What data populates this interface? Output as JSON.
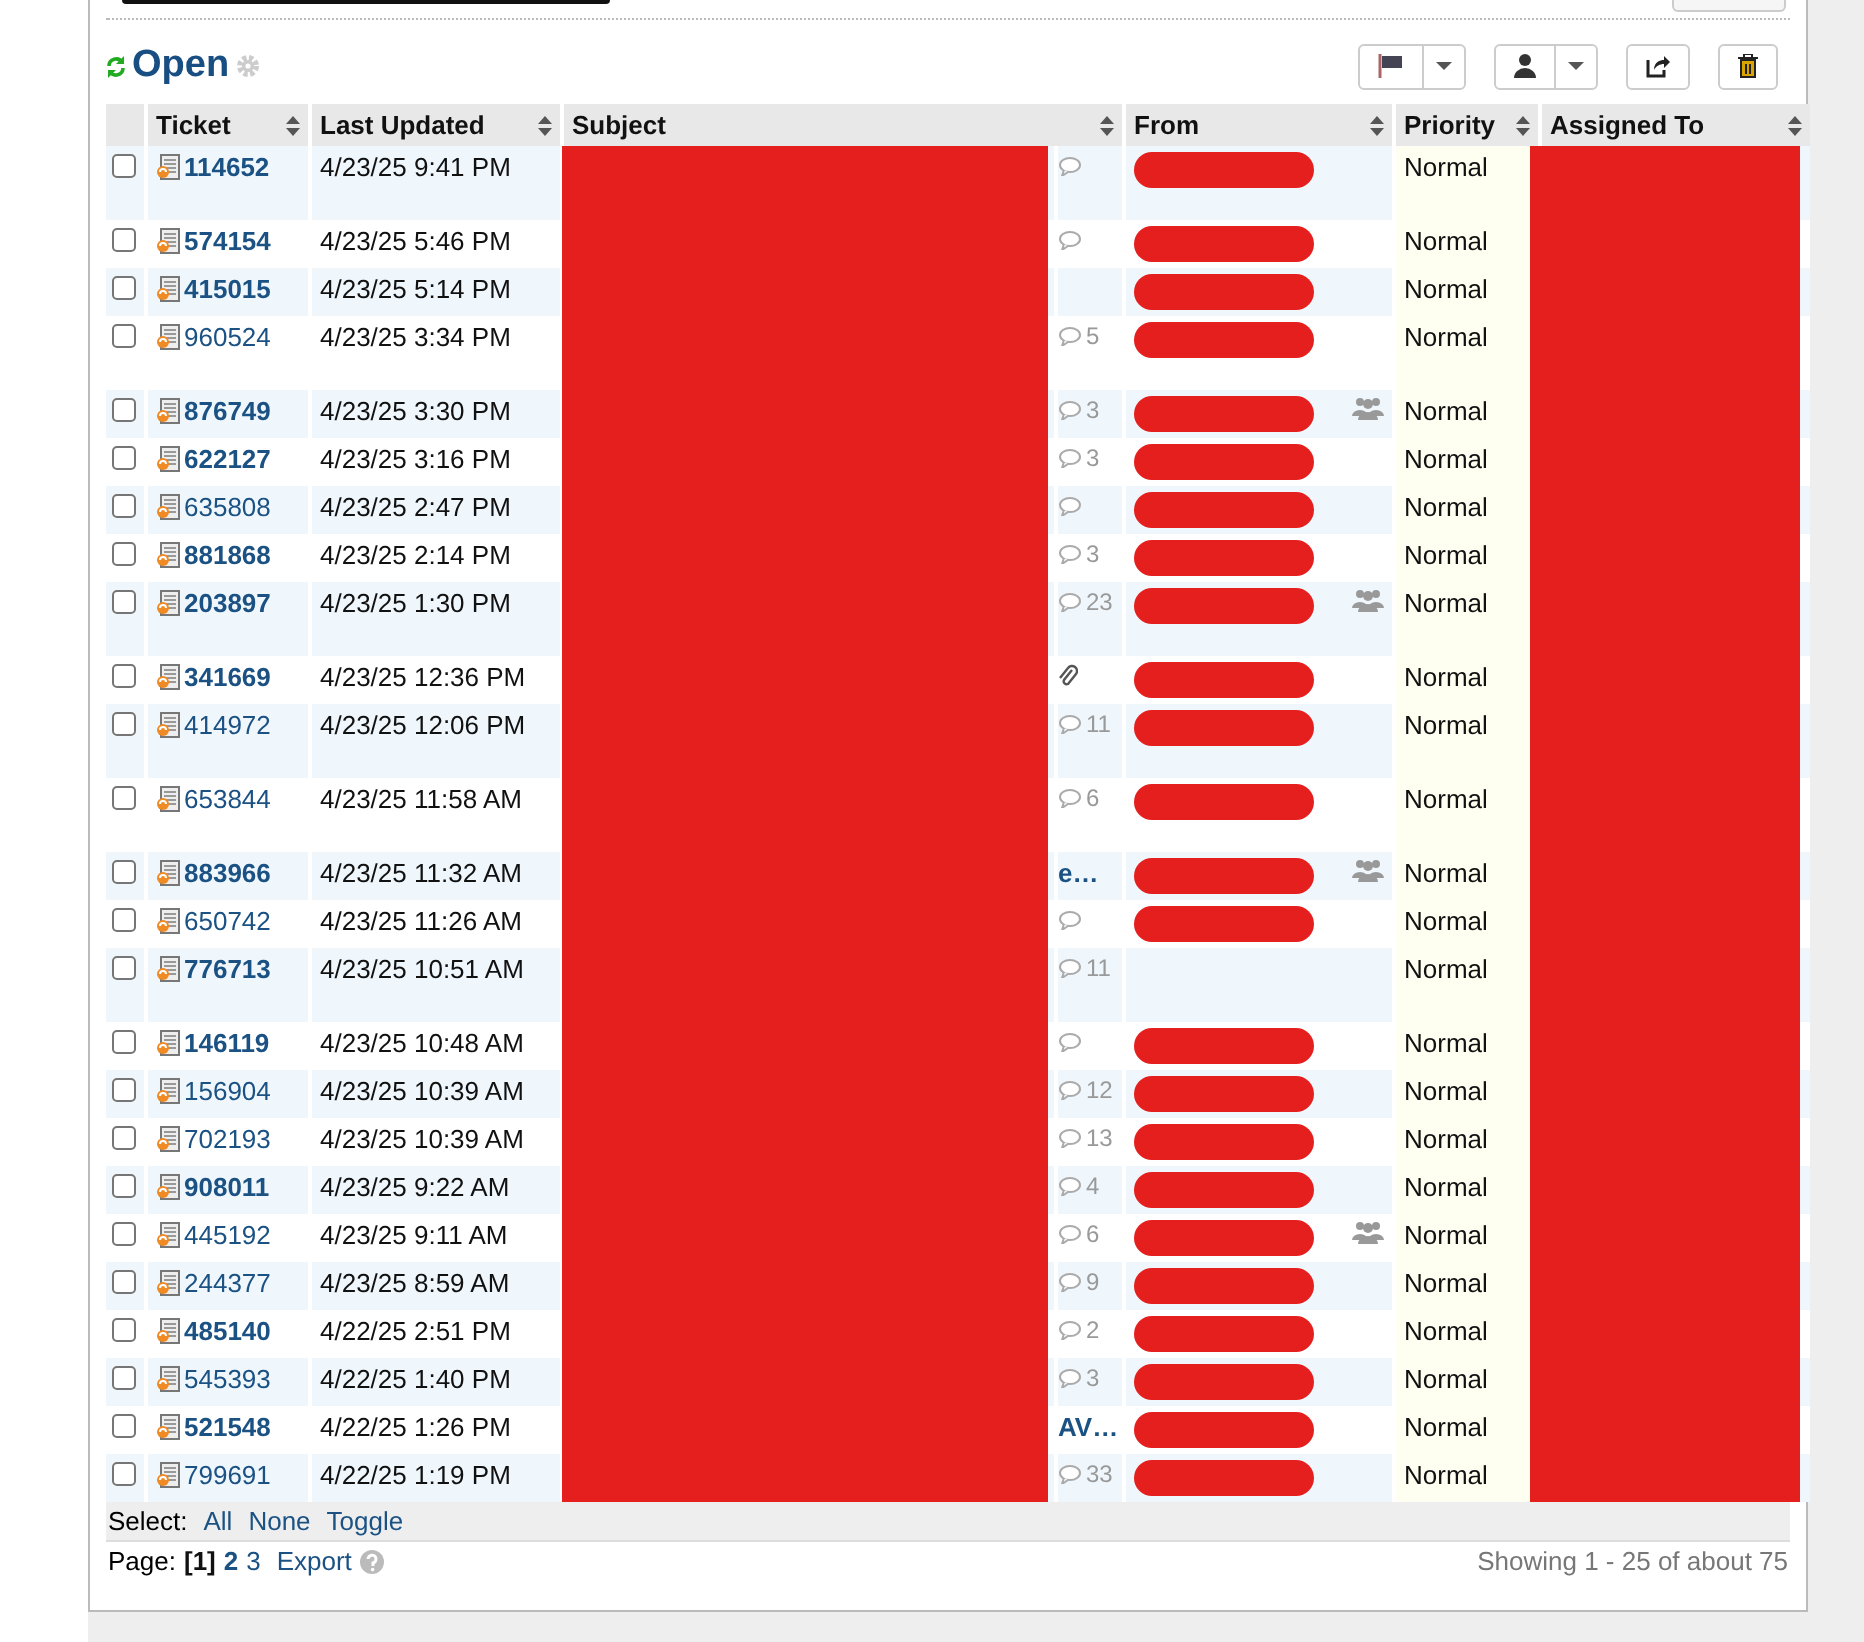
{
  "title": "Open",
  "toolbar": [
    {
      "kind": "flag",
      "dropdown": true
    },
    {
      "kind": "user",
      "dropdown": true
    },
    {
      "kind": "share",
      "dropdown": false
    },
    {
      "kind": "trash",
      "dropdown": false
    }
  ],
  "columns": [
    "Ticket",
    "Last Updated",
    "Subject",
    "From",
    "Priority",
    "Assigned To"
  ],
  "rows": [
    {
      "ticket": "114652",
      "updated": "4/23/25 9:41 PM",
      "unread": true,
      "wrapped": true,
      "checked": false,
      "extra": {
        "kind": "comments"
      },
      "group": false,
      "priority": "Normal"
    },
    {
      "ticket": "574154",
      "updated": "4/23/25 5:46 PM",
      "unread": true,
      "wrapped": false,
      "checked": false,
      "extra": {
        "kind": "comments"
      },
      "group": false,
      "priority": "Normal"
    },
    {
      "ticket": "415015",
      "updated": "4/23/25 5:14 PM",
      "unread": true,
      "wrapped": false,
      "checked": false,
      "extra": {
        "kind": "none"
      },
      "group": false,
      "priority": "Normal"
    },
    {
      "ticket": "960524",
      "updated": "4/23/25 3:34 PM",
      "unread": false,
      "wrapped": true,
      "checked": false,
      "extra": {
        "kind": "comments",
        "count": "5"
      },
      "group": false,
      "priority": "Normal"
    },
    {
      "ticket": "876749",
      "updated": "4/23/25 3:30 PM",
      "unread": true,
      "wrapped": false,
      "checked": false,
      "extra": {
        "kind": "comments",
        "count": "3"
      },
      "group": true,
      "priority": "Normal"
    },
    {
      "ticket": "622127",
      "updated": "4/23/25 3:16 PM",
      "unread": true,
      "wrapped": false,
      "checked": false,
      "extra": {
        "kind": "comments",
        "count": "3"
      },
      "group": false,
      "priority": "Normal"
    },
    {
      "ticket": "635808",
      "updated": "4/23/25 2:47 PM",
      "unread": false,
      "wrapped": false,
      "checked": false,
      "extra": {
        "kind": "comments"
      },
      "group": false,
      "priority": "Normal"
    },
    {
      "ticket": "881868",
      "updated": "4/23/25 2:14 PM",
      "unread": true,
      "wrapped": false,
      "checked": false,
      "extra": {
        "kind": "comments",
        "count": "3"
      },
      "group": false,
      "priority": "Normal"
    },
    {
      "ticket": "203897",
      "updated": "4/23/25 1:30 PM",
      "unread": true,
      "wrapped": true,
      "checked": false,
      "extra": {
        "kind": "comments",
        "count": "23"
      },
      "group": true,
      "priority": "Normal"
    },
    {
      "ticket": "341669",
      "updated": "4/23/25 12:36 PM",
      "unread": true,
      "wrapped": false,
      "checked": false,
      "extra": {
        "kind": "attachment"
      },
      "group": false,
      "priority": "Normal"
    },
    {
      "ticket": "414972",
      "updated": "4/23/25 12:06 PM",
      "unread": false,
      "wrapped": true,
      "checked": false,
      "extra": {
        "kind": "comments",
        "count": "11"
      },
      "group": false,
      "priority": "Normal"
    },
    {
      "ticket": "653844",
      "updated": "4/23/25 11:58 AM",
      "unread": false,
      "wrapped": true,
      "checked": false,
      "extra": {
        "kind": "comments",
        "count": "6"
      },
      "group": false,
      "priority": "Normal"
    },
    {
      "ticket": "883966",
      "updated": "4/23/25 11:32 AM",
      "unread": true,
      "wrapped": false,
      "checked": false,
      "extra": {
        "kind": "tail",
        "text": "e…"
      },
      "group": true,
      "priority": "Normal"
    },
    {
      "ticket": "650742",
      "updated": "4/23/25 11:26 AM",
      "unread": false,
      "wrapped": false,
      "checked": false,
      "extra": {
        "kind": "comments"
      },
      "group": false,
      "priority": "Normal"
    },
    {
      "ticket": "776713",
      "updated": "4/23/25 10:51 AM",
      "unread": true,
      "wrapped": true,
      "checked": false,
      "extra": {
        "kind": "comments",
        "count": "11"
      },
      "group": false,
      "priority": "Normal",
      "blank_from": true
    },
    {
      "ticket": "146119",
      "updated": "4/23/25 10:48 AM",
      "unread": true,
      "wrapped": false,
      "checked": false,
      "extra": {
        "kind": "comments"
      },
      "group": false,
      "priority": "Normal"
    },
    {
      "ticket": "156904",
      "updated": "4/23/25 10:39 AM",
      "unread": false,
      "wrapped": false,
      "checked": false,
      "extra": {
        "kind": "comments",
        "count": "12"
      },
      "group": false,
      "priority": "Normal"
    },
    {
      "ticket": "702193",
      "updated": "4/23/25 10:39 AM",
      "unread": false,
      "wrapped": false,
      "checked": false,
      "extra": {
        "kind": "comments",
        "count": "13"
      },
      "group": false,
      "priority": "Normal"
    },
    {
      "ticket": "908011",
      "updated": "4/23/25 9:22 AM",
      "unread": true,
      "wrapped": false,
      "checked": false,
      "extra": {
        "kind": "comments",
        "count": "4"
      },
      "group": false,
      "priority": "Normal"
    },
    {
      "ticket": "445192",
      "updated": "4/23/25 9:11 AM",
      "unread": false,
      "wrapped": false,
      "checked": false,
      "extra": {
        "kind": "comments",
        "count": "6"
      },
      "group": true,
      "priority": "Normal"
    },
    {
      "ticket": "244377",
      "updated": "4/23/25 8:59 AM",
      "unread": false,
      "wrapped": false,
      "checked": false,
      "extra": {
        "kind": "comments",
        "count": "9"
      },
      "group": false,
      "priority": "Normal"
    },
    {
      "ticket": "485140",
      "updated": "4/22/25 2:51 PM",
      "unread": true,
      "wrapped": false,
      "checked": false,
      "extra": {
        "kind": "comments",
        "count": "2"
      },
      "group": false,
      "priority": "Normal"
    },
    {
      "ticket": "545393",
      "updated": "4/22/25 1:40 PM",
      "unread": false,
      "wrapped": false,
      "checked": false,
      "extra": {
        "kind": "comments",
        "count": "3"
      },
      "group": false,
      "priority": "Normal"
    },
    {
      "ticket": "521548",
      "updated": "4/22/25 1:26 PM",
      "unread": true,
      "wrapped": false,
      "checked": false,
      "extra": {
        "kind": "tail",
        "text": "AV…"
      },
      "group": false,
      "priority": "Normal"
    },
    {
      "ticket": "799691",
      "updated": "4/22/25 1:19 PM",
      "unread": false,
      "wrapped": false,
      "checked": false,
      "extra": {
        "kind": "comments",
        "count": "33"
      },
      "group": false,
      "priority": "Normal"
    }
  ],
  "select": {
    "label": "Select:",
    "links": [
      "All",
      "None",
      "Toggle"
    ]
  },
  "pager": {
    "label": "Page:",
    "pages": [
      {
        "label": "[1]",
        "selected": true
      },
      {
        "label": "2",
        "selected": false
      },
      {
        "label": "3",
        "selected": false
      }
    ],
    "export": "Export"
  },
  "showing": "Showing 1 - 25 of about 75"
}
